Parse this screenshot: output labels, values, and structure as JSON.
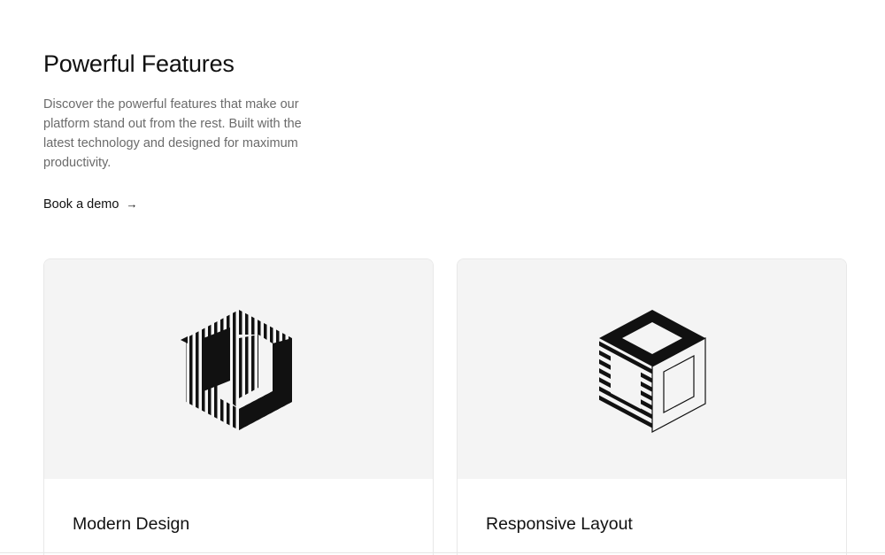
{
  "section": {
    "title": "Powerful Features",
    "description": "Discover the powerful features that make our platform stand out from the rest. Built with the latest technology and designed for maximum productivity.",
    "cta": {
      "label": "Book a demo",
      "icon": "arrow-right-icon"
    }
  },
  "cards": [
    {
      "title": "Modern Design",
      "illustration": "striped-hexagon-illustration"
    },
    {
      "title": "Responsive Layout",
      "illustration": "isometric-cube-illustration"
    }
  ],
  "colors": {
    "background": "#ffffff",
    "card_media_bg": "#f4f4f4",
    "text_primary": "#111111",
    "text_muted": "#6b6b6b",
    "border": "#e8e8e8"
  }
}
